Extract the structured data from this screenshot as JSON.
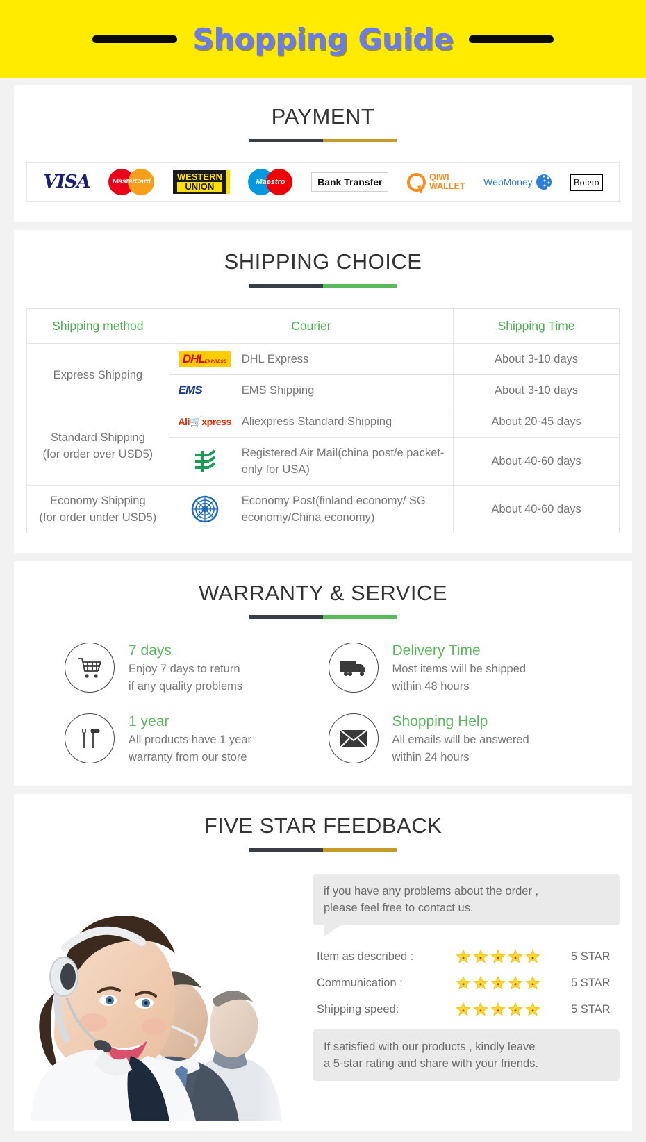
{
  "banner": {
    "title": "Shopping Guide"
  },
  "payment": {
    "heading": "PAYMENT",
    "underline_colors": [
      "#3a3f47",
      "#c49a28"
    ],
    "methods": [
      {
        "name": "visa-logo",
        "label": "VISA"
      },
      {
        "name": "mastercard-logo",
        "label": "MasterCard"
      },
      {
        "name": "western-union-logo",
        "label_line1": "WESTERN",
        "label_line2": "UNION"
      },
      {
        "name": "maestro-logo",
        "label": "Maestro"
      },
      {
        "name": "bank-transfer-logo",
        "label": "Bank Transfer"
      },
      {
        "name": "qiwi-wallet-logo",
        "label_line1": "QIWI",
        "label_line2": "WALLET"
      },
      {
        "name": "webmoney-logo",
        "label": "WebMoney"
      },
      {
        "name": "boleto-logo",
        "label": "Boleto"
      }
    ]
  },
  "shipping": {
    "heading": "SHIPPING CHOICE",
    "underline_colors": [
      "#3a3f47",
      "#5cb85c"
    ],
    "columns": [
      "Shipping method",
      "Courier",
      "Shipping Time"
    ],
    "rows": [
      {
        "method": "Express Shipping",
        "method_line2": "",
        "entries": [
          {
            "logo": "dhl-logo",
            "courier": "DHL Express",
            "time": "About 3-10 days"
          },
          {
            "logo": "ems-logo",
            "courier": "EMS Shipping",
            "time": "About 3-10 days"
          }
        ]
      },
      {
        "method": "Standard Shipping",
        "method_line2": "(for order over USD5)",
        "entries": [
          {
            "logo": "aliexpress-logo",
            "courier": "Aliexpress Standard Shipping",
            "time": "About 20-45 days"
          },
          {
            "logo": "china-post-logo",
            "courier": "Registered Air Mail(china post/e packet-only for USA)",
            "time": "About 40-60 days"
          }
        ]
      },
      {
        "method": "Economy Shipping",
        "method_line2": "(for order under USD5)",
        "entries": [
          {
            "logo": "un-logo",
            "courier": "Economy Post(finland economy/ SG economy/China economy)",
            "time": "About 40-60 days"
          }
        ]
      }
    ]
  },
  "warranty": {
    "heading": "WARRANTY & SERVICE",
    "underline_colors": [
      "#3a3f47",
      "#5cb85c"
    ],
    "items": [
      {
        "icon": "shopping-cart-icon",
        "title": "7 days",
        "line1": "Enjoy 7 days to return",
        "line2": "if any quality problems"
      },
      {
        "icon": "delivery-truck-icon",
        "title": "Delivery Time",
        "line1": "Most items will be shipped",
        "line2": "within 48 hours"
      },
      {
        "icon": "tools-icon",
        "title": "1 year",
        "line1": "All products have 1 year",
        "line2": "warranty from our store"
      },
      {
        "icon": "envelope-icon",
        "title": "Shopping Help",
        "line1": "All emails will be answered",
        "line2": "within 24 hours"
      }
    ]
  },
  "feedback": {
    "heading": "FIVE STAR FEEDBACK",
    "underline_colors": [
      "#3a3f47",
      "#c49a28"
    ],
    "photo_alt": "call-center-agents-photo",
    "bubble_top_line1": "if you have any problems about the order ,",
    "bubble_top_line2": "please feel free to contact us.",
    "ratings": [
      {
        "label": "Item as described :",
        "stars": 5,
        "value": "5 STAR"
      },
      {
        "label": "Communication :",
        "stars": 5,
        "value": "5 STAR"
      },
      {
        "label": "Shipping speed:",
        "stars": 5,
        "value": "5 STAR"
      }
    ],
    "bubble_bottom_line1": "If satisfied with our products ,  kindly leave",
    "bubble_bottom_line2": "a 5-star rating and share with your friends."
  }
}
